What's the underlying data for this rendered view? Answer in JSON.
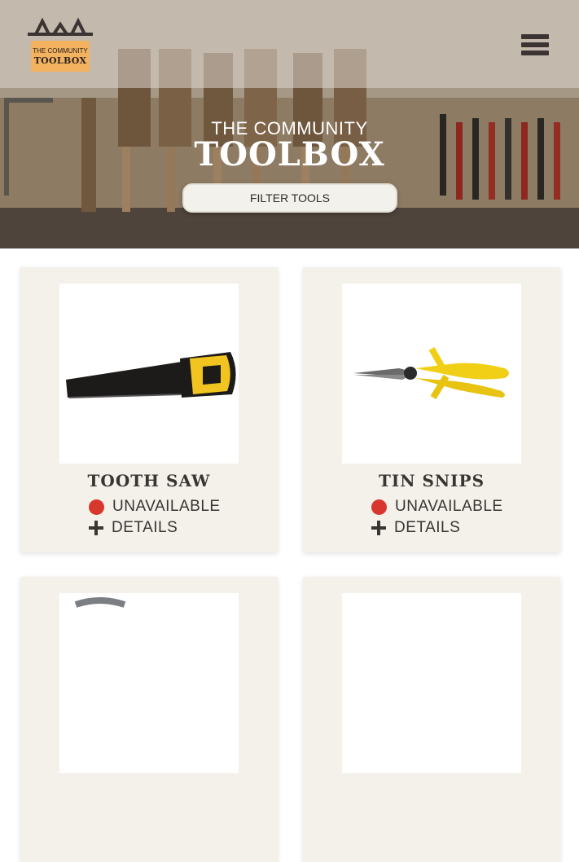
{
  "header": {
    "logo_line1": "THE COMMUNITY",
    "logo_line2": "TOOLBOX",
    "menu_icon": "hamburger-menu-icon"
  },
  "hero": {
    "title_small": "THE COMMUNITY",
    "title_large": "TOOLBOX",
    "filter_label": "FILTER TOOLS"
  },
  "tools": [
    {
      "name": "TOOTH SAW",
      "status": "UNAVAILABLE",
      "details_label": "DETAILS",
      "image_icon": "hand-saw-icon"
    },
    {
      "name": "TIN SNIPS",
      "status": "UNAVAILABLE",
      "details_label": "DETAILS",
      "image_icon": "tin-snips-icon"
    }
  ],
  "colors": {
    "logo_badge": "#f3b25f",
    "unavailable_dot": "#d8372e",
    "card_bg": "#f3f1ea",
    "text_dark": "#3a3432"
  }
}
